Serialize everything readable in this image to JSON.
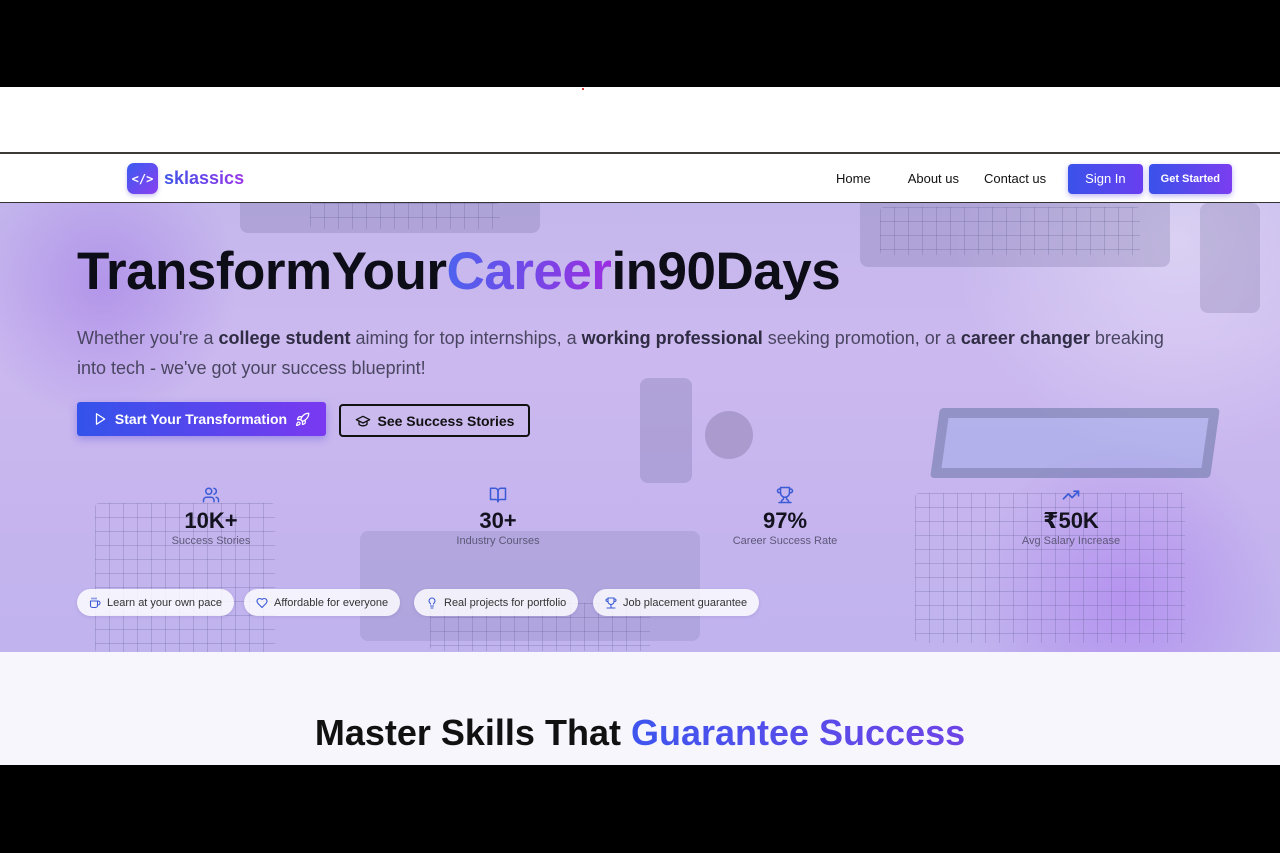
{
  "brand": {
    "logo_mark": "</>",
    "name": "sklassics"
  },
  "nav": {
    "links": [
      "Home",
      "About us",
      "Contact us"
    ],
    "sign_in": "Sign In",
    "get_started": "Get Started"
  },
  "hero": {
    "title_part1": "TransformYour",
    "title_highlight": "Career",
    "title_part2": "in90Days",
    "subtitle": {
      "t1": "Whether you're a ",
      "b1": "college student",
      "t2": " aiming for top internships, a ",
      "b2": "working professional",
      "t3": " seeking promotion, or a ",
      "b3": "career changer",
      "t4": " breaking into tech - we've got your success blueprint!"
    },
    "cta_primary": "Start Your Transformation",
    "cta_secondary": "See Success Stories"
  },
  "stats": [
    {
      "icon": "users-icon",
      "value": "10K+",
      "label": "Success Stories"
    },
    {
      "icon": "book-open-icon",
      "value": "30+",
      "label": "Industry Courses"
    },
    {
      "icon": "trophy-icon",
      "value": "97%",
      "label": "Career Success Rate"
    },
    {
      "icon": "trending-up-icon",
      "value": "₹50K",
      "label": "Avg Salary Increase"
    }
  ],
  "features": [
    {
      "icon": "coffee-icon",
      "label": "Learn at your own pace"
    },
    {
      "icon": "heart-icon",
      "label": "Affordable for everyone"
    },
    {
      "icon": "lightbulb-icon",
      "label": "Real projects for portfolio"
    },
    {
      "icon": "trophy-icon",
      "label": "Job placement guarantee"
    }
  ],
  "section2": {
    "title_part1": "Master Skills That ",
    "title_highlight": "Guarantee Success"
  },
  "colors": {
    "accent_blue": "#3a52ea",
    "accent_purple": "#7b3df0",
    "icon_blue": "#3b5bd6",
    "text_dark": "#0d0d18"
  }
}
